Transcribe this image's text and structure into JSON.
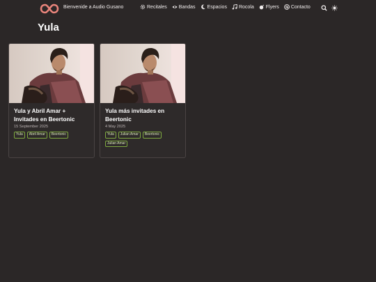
{
  "brand": {
    "name": "Bienvenide a Audio Gusano",
    "logo_icon": "infinity-logo",
    "accent": "#e9847b"
  },
  "nav": {
    "items": [
      {
        "label": "Recitales",
        "icon": "gear-icon"
      },
      {
        "label": "Bandas",
        "icon": "eye-icon"
      },
      {
        "label": "Espacios",
        "icon": "moon-icon"
      },
      {
        "label": "Rocola",
        "icon": "music-note-icon"
      },
      {
        "label": "Flyers",
        "icon": "bomb-icon"
      },
      {
        "label": "Contacto",
        "icon": "at-icon"
      }
    ],
    "search_icon": "search-icon",
    "theme_icon": "sun-icon"
  },
  "page": {
    "title": "Yula"
  },
  "cards": [
    {
      "title": "Yula y Abril Amar + Invitades en Beertonic",
      "date": "15 September 2025",
      "tags": [
        "Yula",
        "Abril Amar",
        "Beertonic"
      ]
    },
    {
      "title": "Yula más invitades en Beertonic",
      "date": "4 May 2025",
      "tags": [
        "Yula",
        "Julian Amar",
        "Beertonic",
        "Julian Amar"
      ]
    }
  ],
  "colors": {
    "background": "#2b2727",
    "card": "#2e2a2a",
    "tag_border": "#7faa40"
  }
}
